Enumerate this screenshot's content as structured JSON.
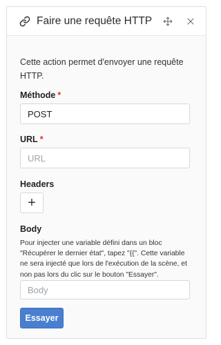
{
  "header": {
    "title": "Faire une requête HTTP"
  },
  "description": "Cette action permet d'envoyer une requête HTTP.",
  "method": {
    "label": "Méthode",
    "required": "*",
    "value": "POST"
  },
  "url": {
    "label": "URL",
    "required": "*",
    "placeholder": "URL"
  },
  "headers": {
    "label": "Headers",
    "add": "+"
  },
  "body": {
    "label": "Body",
    "hint": "Pour injecter une variable défini dans un bloc \"Récupérer le dernier état\", tapez \"{{\". Cette variable ne sera injecté que lors de l'exécution de la scène, et non pas lors du clic sur le bouton \"Essayer\".",
    "placeholder": "Body"
  },
  "submit_label": "Essayer"
}
